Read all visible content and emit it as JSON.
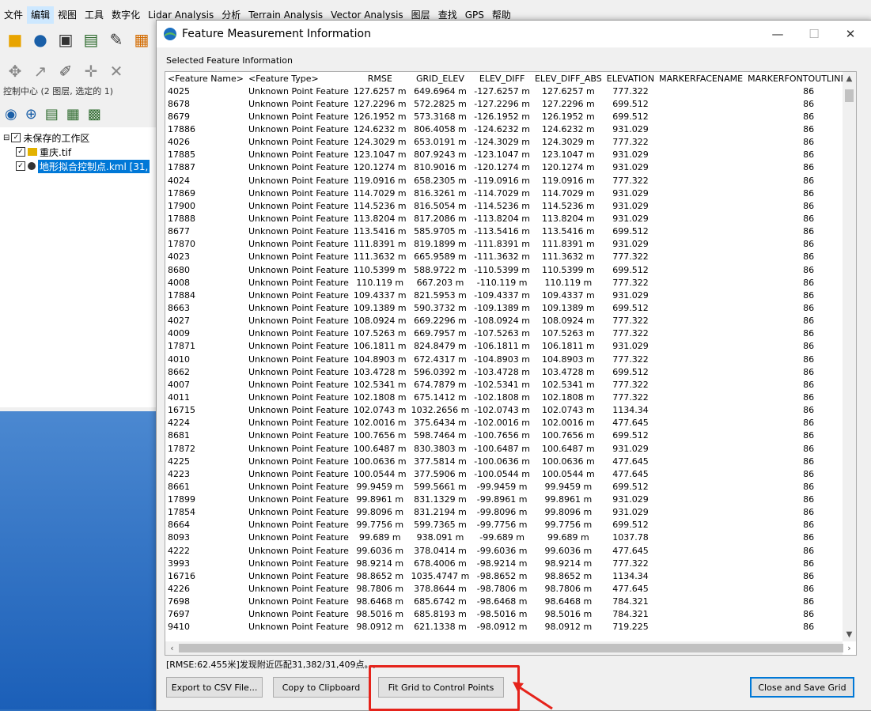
{
  "menu": [
    "文件",
    "编辑",
    "视图",
    "工具",
    "数字化",
    "Lidar Analysis",
    "分析",
    "Terrain Analysis",
    "Vector Analysis",
    "图层",
    "查找",
    "GPS",
    "帮助"
  ],
  "left_panel": {
    "title": "控制中心 (2 图层, 选定的 1)",
    "workspace": "未保存的工作区",
    "layer1": "重庆.tif",
    "layer2": "地形拟合控制点.kml [31,"
  },
  "dialog": {
    "title": "Feature Measurement Information",
    "group_label": "Selected Feature Information",
    "minimize": "—",
    "maximize": "☐",
    "close": "✕",
    "status": "[RMSE:62.455米]发现附近匹配31,382/31,409点。,",
    "buttons": {
      "export": "Export to CSV File...",
      "copy": "Copy to Clipboard",
      "fit": "Fit Grid to Control Points",
      "close_save": "Close and Save Grid"
    }
  },
  "table": {
    "columns": [
      "<Feature Name>",
      "<Feature Type>",
      "RMSE",
      "GRID_ELEV",
      "ELEV_DIFF",
      "ELEV_DIFF_ABS",
      "ELEVATION",
      "MARKERFACENAME",
      "MARKERFONTOUTLINEWEIG"
    ],
    "rows": [
      [
        "4025",
        "Unknown Point Feature",
        "127.6257 m",
        "649.6964 m",
        "-127.6257 m",
        "127.6257 m",
        "777.322",
        "",
        "86"
      ],
      [
        "8678",
        "Unknown Point Feature",
        "127.2296 m",
        "572.2825 m",
        "-127.2296 m",
        "127.2296 m",
        "699.512",
        "",
        "86"
      ],
      [
        "8679",
        "Unknown Point Feature",
        "126.1952 m",
        "573.3168 m",
        "-126.1952 m",
        "126.1952 m",
        "699.512",
        "",
        "86"
      ],
      [
        "17886",
        "Unknown Point Feature",
        "124.6232 m",
        "806.4058 m",
        "-124.6232 m",
        "124.6232 m",
        "931.029",
        "",
        "86"
      ],
      [
        "4026",
        "Unknown Point Feature",
        "124.3029 m",
        "653.0191 m",
        "-124.3029 m",
        "124.3029 m",
        "777.322",
        "",
        "86"
      ],
      [
        "17885",
        "Unknown Point Feature",
        "123.1047 m",
        "807.9243 m",
        "-123.1047 m",
        "123.1047 m",
        "931.029",
        "",
        "86"
      ],
      [
        "17887",
        "Unknown Point Feature",
        "120.1274 m",
        "810.9016 m",
        "-120.1274 m",
        "120.1274 m",
        "931.029",
        "",
        "86"
      ],
      [
        "4024",
        "Unknown Point Feature",
        "119.0916 m",
        "658.2305 m",
        "-119.0916 m",
        "119.0916 m",
        "777.322",
        "",
        "86"
      ],
      [
        "17869",
        "Unknown Point Feature",
        "114.7029 m",
        "816.3261 m",
        "-114.7029 m",
        "114.7029 m",
        "931.029",
        "",
        "86"
      ],
      [
        "17900",
        "Unknown Point Feature",
        "114.5236 m",
        "816.5054 m",
        "-114.5236 m",
        "114.5236 m",
        "931.029",
        "",
        "86"
      ],
      [
        "17888",
        "Unknown Point Feature",
        "113.8204 m",
        "817.2086 m",
        "-113.8204 m",
        "113.8204 m",
        "931.029",
        "",
        "86"
      ],
      [
        "8677",
        "Unknown Point Feature",
        "113.5416 m",
        "585.9705 m",
        "-113.5416 m",
        "113.5416 m",
        "699.512",
        "",
        "86"
      ],
      [
        "17870",
        "Unknown Point Feature",
        "111.8391 m",
        "819.1899 m",
        "-111.8391 m",
        "111.8391 m",
        "931.029",
        "",
        "86"
      ],
      [
        "4023",
        "Unknown Point Feature",
        "111.3632 m",
        "665.9589 m",
        "-111.3632 m",
        "111.3632 m",
        "777.322",
        "",
        "86"
      ],
      [
        "8680",
        "Unknown Point Feature",
        "110.5399 m",
        "588.9722 m",
        "-110.5399 m",
        "110.5399 m",
        "699.512",
        "",
        "86"
      ],
      [
        "4008",
        "Unknown Point Feature",
        "110.119 m",
        "667.203 m",
        "-110.119 m",
        "110.119 m",
        "777.322",
        "",
        "86"
      ],
      [
        "17884",
        "Unknown Point Feature",
        "109.4337 m",
        "821.5953 m",
        "-109.4337 m",
        "109.4337 m",
        "931.029",
        "",
        "86"
      ],
      [
        "8663",
        "Unknown Point Feature",
        "109.1389 m",
        "590.3732 m",
        "-109.1389 m",
        "109.1389 m",
        "699.512",
        "",
        "86"
      ],
      [
        "4027",
        "Unknown Point Feature",
        "108.0924 m",
        "669.2296 m",
        "-108.0924 m",
        "108.0924 m",
        "777.322",
        "",
        "86"
      ],
      [
        "4009",
        "Unknown Point Feature",
        "107.5263 m",
        "669.7957 m",
        "-107.5263 m",
        "107.5263 m",
        "777.322",
        "",
        "86"
      ],
      [
        "17871",
        "Unknown Point Feature",
        "106.1811 m",
        "824.8479 m",
        "-106.1811 m",
        "106.1811 m",
        "931.029",
        "",
        "86"
      ],
      [
        "4010",
        "Unknown Point Feature",
        "104.8903 m",
        "672.4317 m",
        "-104.8903 m",
        "104.8903 m",
        "777.322",
        "",
        "86"
      ],
      [
        "8662",
        "Unknown Point Feature",
        "103.4728 m",
        "596.0392 m",
        "-103.4728 m",
        "103.4728 m",
        "699.512",
        "",
        "86"
      ],
      [
        "4007",
        "Unknown Point Feature",
        "102.5341 m",
        "674.7879 m",
        "-102.5341 m",
        "102.5341 m",
        "777.322",
        "",
        "86"
      ],
      [
        "4011",
        "Unknown Point Feature",
        "102.1808 m",
        "675.1412 m",
        "-102.1808 m",
        "102.1808 m",
        "777.322",
        "",
        "86"
      ],
      [
        "16715",
        "Unknown Point Feature",
        "102.0743 m",
        "1032.2656 m",
        "-102.0743 m",
        "102.0743 m",
        "1134.34",
        "",
        "86"
      ],
      [
        "4224",
        "Unknown Point Feature",
        "102.0016 m",
        "375.6434 m",
        "-102.0016 m",
        "102.0016 m",
        "477.645",
        "",
        "86"
      ],
      [
        "8681",
        "Unknown Point Feature",
        "100.7656 m",
        "598.7464 m",
        "-100.7656 m",
        "100.7656 m",
        "699.512",
        "",
        "86"
      ],
      [
        "17872",
        "Unknown Point Feature",
        "100.6487 m",
        "830.3803 m",
        "-100.6487 m",
        "100.6487 m",
        "931.029",
        "",
        "86"
      ],
      [
        "4225",
        "Unknown Point Feature",
        "100.0636 m",
        "377.5814 m",
        "-100.0636 m",
        "100.0636 m",
        "477.645",
        "",
        "86"
      ],
      [
        "4223",
        "Unknown Point Feature",
        "100.0544 m",
        "377.5906 m",
        "-100.0544 m",
        "100.0544 m",
        "477.645",
        "",
        "86"
      ],
      [
        "8661",
        "Unknown Point Feature",
        "99.9459 m",
        "599.5661 m",
        "-99.9459 m",
        "99.9459 m",
        "699.512",
        "",
        "86"
      ],
      [
        "17899",
        "Unknown Point Feature",
        "99.8961 m",
        "831.1329 m",
        "-99.8961 m",
        "99.8961 m",
        "931.029",
        "",
        "86"
      ],
      [
        "17854",
        "Unknown Point Feature",
        "99.8096 m",
        "831.2194 m",
        "-99.8096 m",
        "99.8096 m",
        "931.029",
        "",
        "86"
      ],
      [
        "8664",
        "Unknown Point Feature",
        "99.7756 m",
        "599.7365 m",
        "-99.7756 m",
        "99.7756 m",
        "699.512",
        "",
        "86"
      ],
      [
        "8093",
        "Unknown Point Feature",
        "99.689 m",
        "938.091 m",
        "-99.689 m",
        "99.689 m",
        "1037.78",
        "",
        "86"
      ],
      [
        "4222",
        "Unknown Point Feature",
        "99.6036 m",
        "378.0414 m",
        "-99.6036 m",
        "99.6036 m",
        "477.645",
        "",
        "86"
      ],
      [
        "3993",
        "Unknown Point Feature",
        "98.9214 m",
        "678.4006 m",
        "-98.9214 m",
        "98.9214 m",
        "777.322",
        "",
        "86"
      ],
      [
        "16716",
        "Unknown Point Feature",
        "98.8652 m",
        "1035.4747 m",
        "-98.8652 m",
        "98.8652 m",
        "1134.34",
        "",
        "86"
      ],
      [
        "4226",
        "Unknown Point Feature",
        "98.7806 m",
        "378.8644 m",
        "-98.7806 m",
        "98.7806 m",
        "477.645",
        "",
        "86"
      ],
      [
        "7698",
        "Unknown Point Feature",
        "98.6468 m",
        "685.6742 m",
        "-98.6468 m",
        "98.6468 m",
        "784.321",
        "",
        "86"
      ],
      [
        "7697",
        "Unknown Point Feature",
        "98.5016 m",
        "685.8193 m",
        "-98.5016 m",
        "98.5016 m",
        "784.321",
        "",
        "86"
      ],
      [
        "9410",
        "Unknown Point Feature",
        "98.0912 m",
        "621.1338 m",
        "-98.0912 m",
        "98.0912 m",
        "719.225",
        "",
        "86"
      ]
    ]
  },
  "colors": {
    "accent": "#0078d7",
    "highlight_box": "#e5231b"
  }
}
